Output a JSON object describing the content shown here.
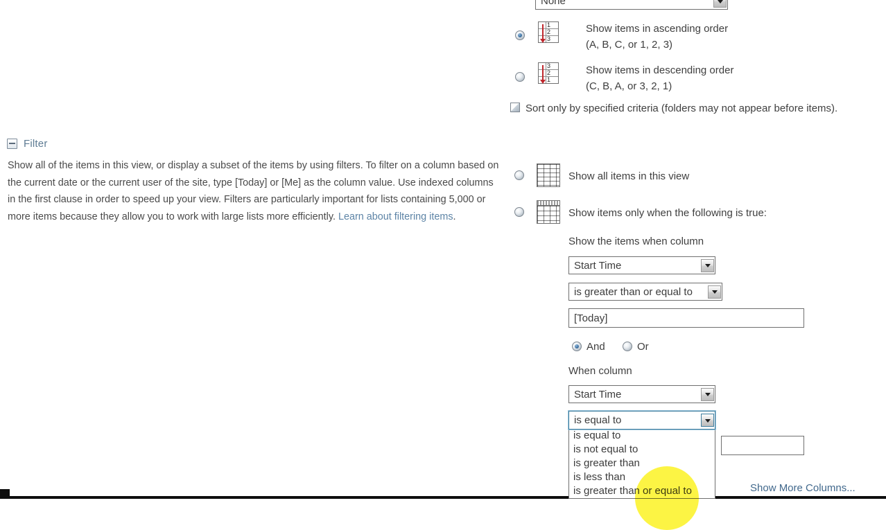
{
  "sort": {
    "column_select_value": "None",
    "ascending": {
      "title": "Show items in ascending order",
      "subtitle": "(A, B, C, or 1, 2, 3)",
      "selected": true,
      "icon_digits": [
        "1",
        "2",
        "3"
      ]
    },
    "descending": {
      "title": "Show items in descending order",
      "subtitle": "(C, B, A, or 3, 2, 1)",
      "selected": false,
      "icon_digits": [
        "3",
        "2",
        "1"
      ]
    },
    "sort_only_checkbox": {
      "label": "Sort only by specified criteria (folders may not appear before items).",
      "checked": false
    }
  },
  "filter": {
    "section_title": "Filter",
    "description_part1": "Show all of the items in this view, or display a subset of the items by using filters. To filter on a column based on the current date or the current user of the site, type [Today] or [Me] as the column value. Use indexed columns in the first clause in order to speed up your view. Filters are particularly important for lists containing 5,000 or more items because they allow you to work with large lists more efficiently. ",
    "description_link": "Learn about filtering items",
    "description_end": ".",
    "show_all": {
      "label": "Show all items in this view",
      "selected": false
    },
    "show_conditional": {
      "label": "Show items only when the following is true:",
      "selected": true
    },
    "clause1": {
      "heading": "Show the items when column",
      "column_value": "Start Time",
      "comparison_value": "is greater than or equal to",
      "value_text": "[Today]"
    },
    "conjunction": {
      "and_label": "And",
      "or_label": "Or",
      "selected": "And"
    },
    "clause2": {
      "heading": "When column",
      "column_value": "Start Time",
      "comparison_value": "is equal to",
      "value_text": "",
      "dropdown_open": true,
      "dropdown_options": [
        "is equal to",
        "is not equal to",
        "is greater than",
        "is less than",
        "is greater than or equal to"
      ]
    },
    "show_more_columns_link": "Show More Columns..."
  },
  "colors": {
    "section_title": "#5d7b93",
    "link": "#41688c",
    "highlight": "#fcf21a",
    "text": "#3f3f3f"
  }
}
